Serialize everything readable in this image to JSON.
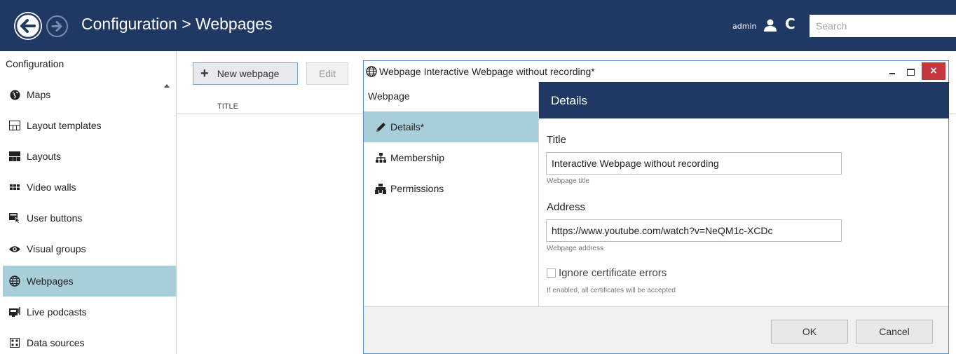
{
  "header": {
    "title": "Configuration > Webpages",
    "user": "admin",
    "search_placeholder": "Search",
    "bg_color": "#1f3864"
  },
  "sidebar": {
    "heading": "Configuration",
    "items": [
      {
        "label": "Maps",
        "icon": "globe-icon"
      },
      {
        "label": "Layout templates",
        "icon": "layout-template-icon"
      },
      {
        "label": "Layouts",
        "icon": "layout-icon"
      },
      {
        "label": "Video walls",
        "icon": "video-wall-icon"
      },
      {
        "label": "User buttons",
        "icon": "user-button-icon"
      },
      {
        "label": "Visual groups",
        "icon": "eye-icon"
      },
      {
        "label": "Webpages",
        "icon": "web-globe-icon",
        "active": true
      },
      {
        "label": "Live podcasts",
        "icon": "podcast-icon"
      },
      {
        "label": "Data sources",
        "icon": "data-source-icon"
      }
    ]
  },
  "toolbar": {
    "new_label": "New webpage",
    "edit_label": "Edit"
  },
  "table": {
    "columns": [
      "TITLE"
    ]
  },
  "dialog": {
    "title": "Webpage Interactive Webpage without recording*",
    "nav_heading": "Webpage",
    "nav": [
      {
        "label": "Details*",
        "icon": "pencil-icon",
        "active": true
      },
      {
        "label": "Membership",
        "icon": "hierarchy-icon"
      },
      {
        "label": "Permissions",
        "icon": "permissions-icon"
      }
    ],
    "section_title": "Details",
    "fields": {
      "title_label": "Title",
      "title_value": "Interactive Webpage without recording",
      "title_help": "Webpage title",
      "address_label": "Address",
      "address_value": "https://www.youtube.com/watch?v=NeQM1c-XCDc",
      "address_help": "Webpage address",
      "ignore_cert_label": "Ignore certificate errors",
      "ignore_cert_checked": false,
      "ignore_cert_help": "If enabled, all certificates will be accepted"
    },
    "ok_label": "OK",
    "cancel_label": "Cancel",
    "close_glyph": "×"
  },
  "colors": {
    "accent_selected": "#a8cfd9",
    "close_button": "#c7373f"
  }
}
